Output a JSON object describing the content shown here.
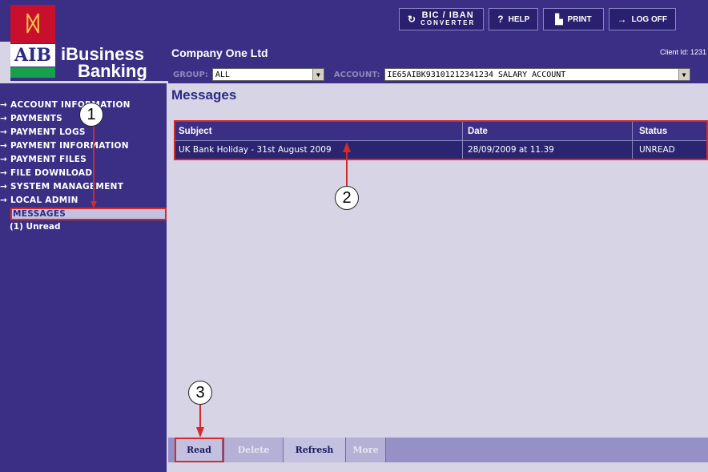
{
  "brand": {
    "aib": "AIB",
    "ibusiness": "iBusiness",
    "banking": "Banking"
  },
  "toolbar": {
    "bic_line1": "BIC / IBAN",
    "bic_line2": "CONVERTER",
    "help": "HELP",
    "print": "PRINT",
    "logoff": "LOG OFF"
  },
  "header": {
    "company": "Company One Ltd",
    "client_id": "Client Id: 1231"
  },
  "filters": {
    "group_label": "GROUP:",
    "group_value": "ALL",
    "account_label": "ACCOUNT:",
    "account_value": "IE65AIBK93101212341234 SALARY ACCOUNT"
  },
  "sidebar": {
    "items": [
      {
        "label": "→ ACCOUNT INFORMATION"
      },
      {
        "label": "→ PAYMENTS"
      },
      {
        "label": "→ PAYMENT LOGS"
      },
      {
        "label": "→ PAYMENT INFORMATION"
      },
      {
        "label": "→ PAYMENT FILES"
      },
      {
        "label": "→ FILE DOWNLOAD"
      },
      {
        "label": "→ SYSTEM MANAGEMENT"
      },
      {
        "label": "→ LOCAL ADMIN"
      }
    ],
    "active": "MESSAGES",
    "sub": "(1) Unread"
  },
  "main": {
    "title": "Messages",
    "columns": [
      "Subject",
      "Date",
      "Status"
    ],
    "rows": [
      {
        "subject": "UK Bank Holiday - 31st August 2009",
        "date": "28/09/2009 at 11.39",
        "status": "UNREAD"
      }
    ]
  },
  "actions": {
    "read": "Read",
    "delete": "Delete",
    "refresh": "Refresh",
    "more": "More"
  },
  "callouts": [
    "1",
    "2",
    "3"
  ]
}
